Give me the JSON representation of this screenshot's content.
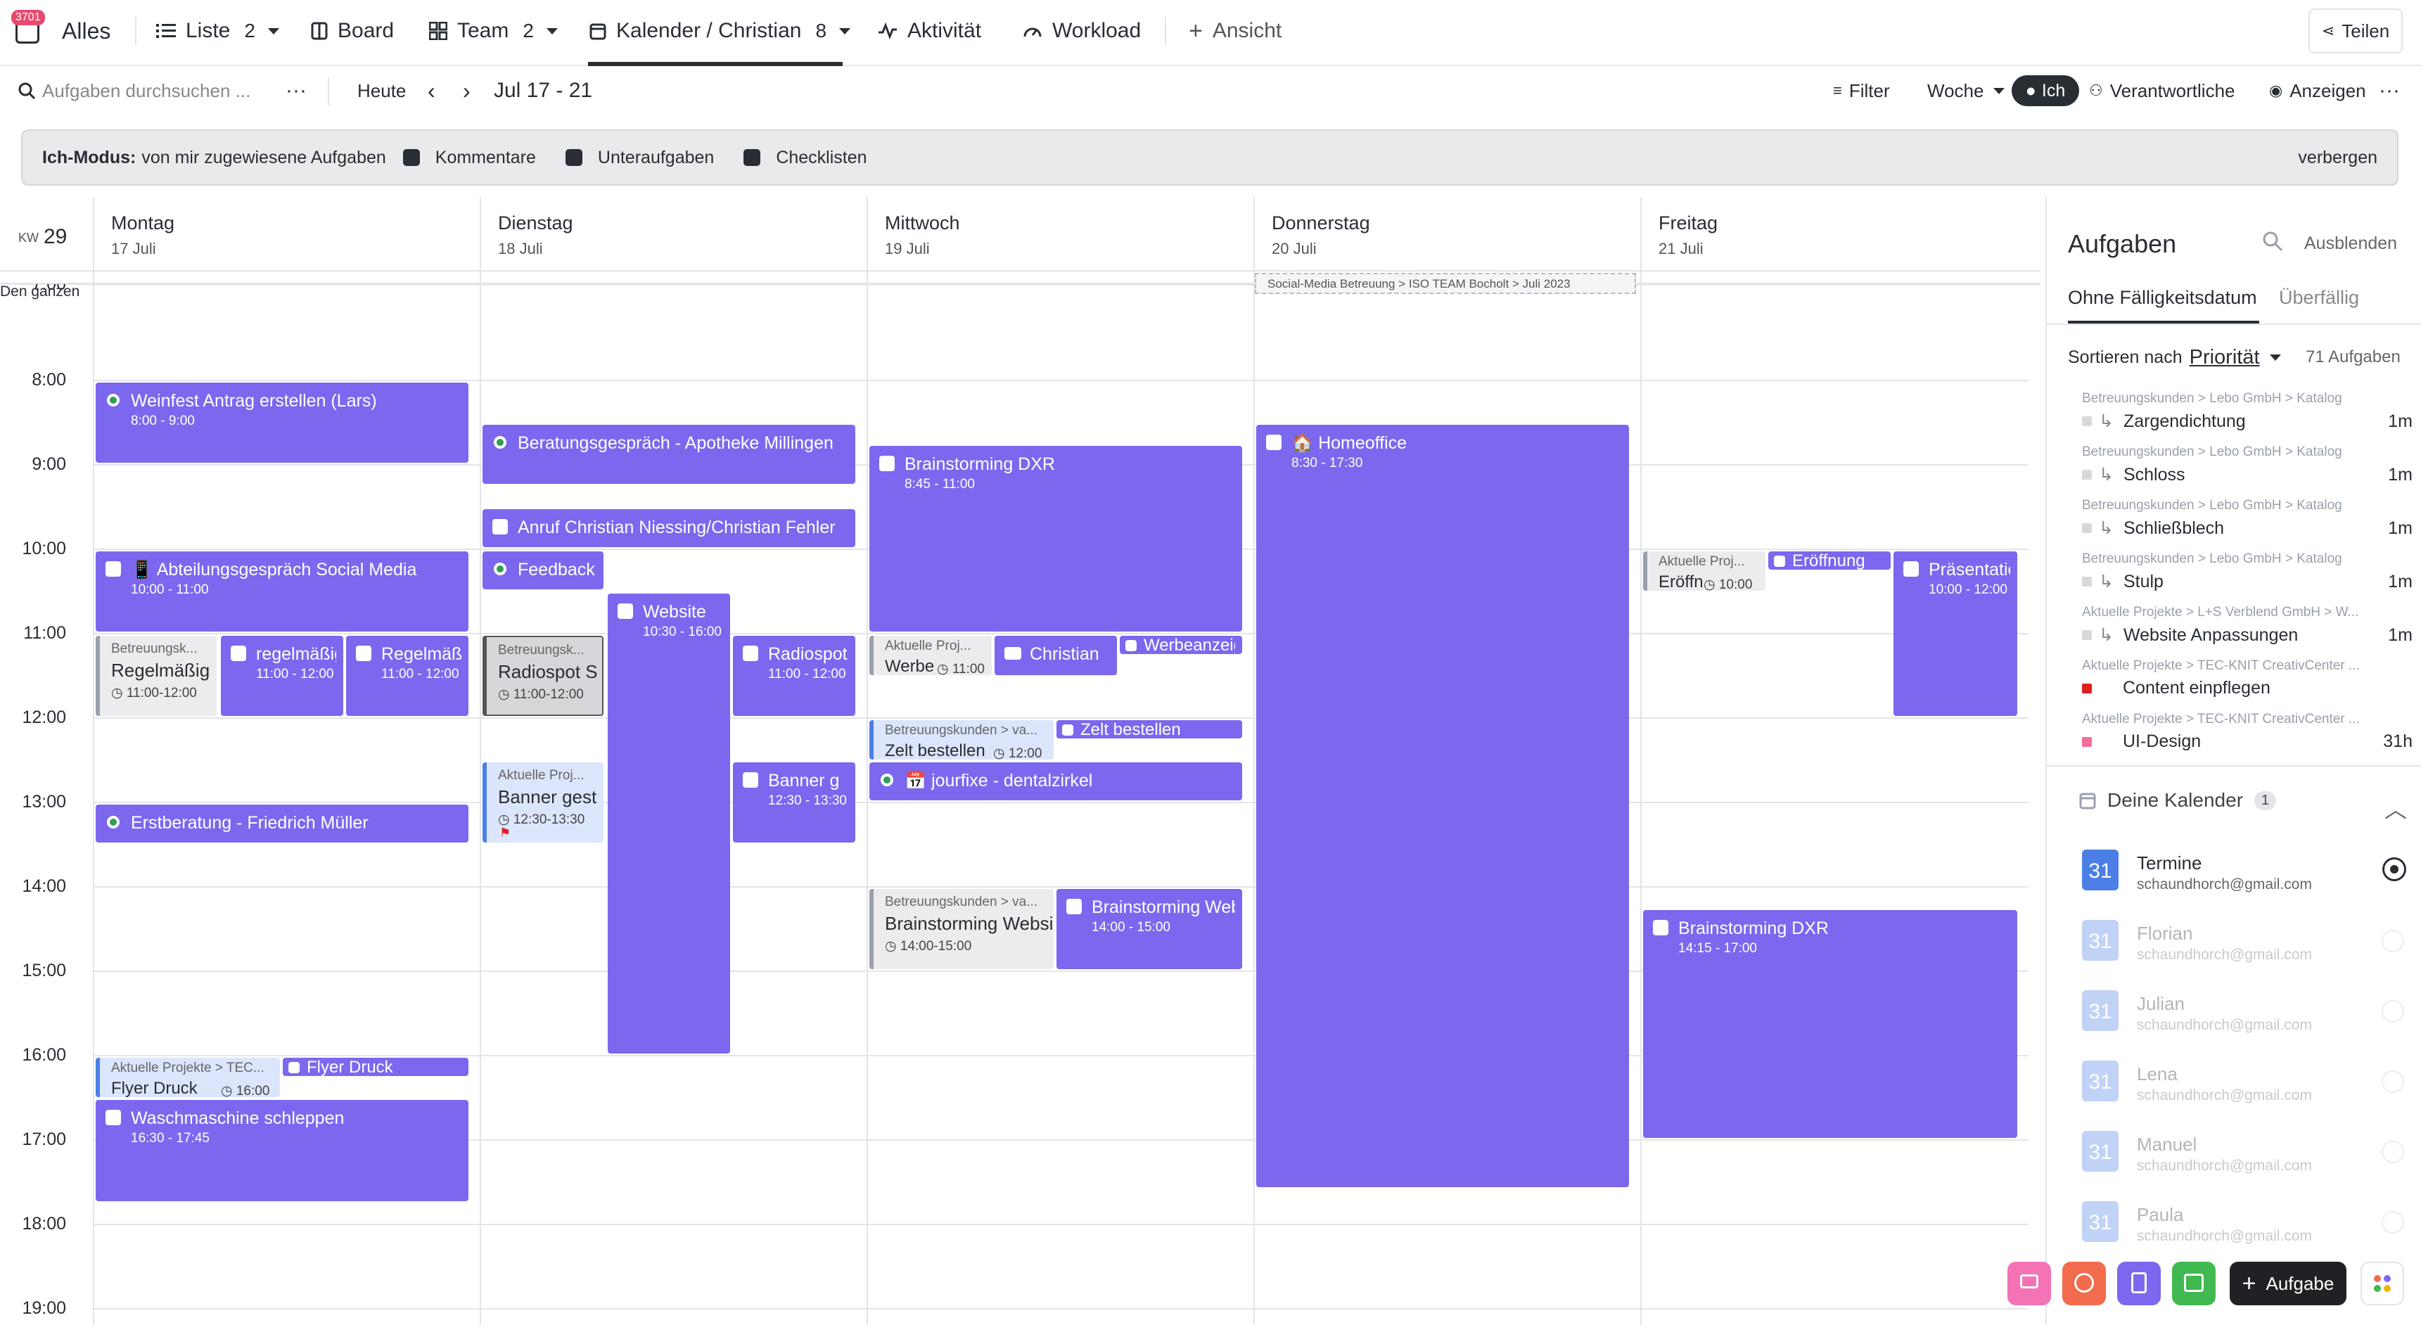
{
  "app": {
    "badge": "3701",
    "title": "Alles"
  },
  "tabs": [
    {
      "label": "Liste",
      "count": "2"
    },
    {
      "label": "Board"
    },
    {
      "label": "Team",
      "count": "2"
    },
    {
      "label": "Kalender / Christian",
      "count": "8"
    },
    {
      "label": "Aktivität"
    },
    {
      "label": "Workload"
    },
    {
      "label": "Ansicht"
    }
  ],
  "share": "Teilen",
  "toolbar": {
    "search_placeholder": "Aufgaben durchsuchen ...",
    "today": "Heute",
    "range": "Jul 17 - 21",
    "filter": "Filter",
    "week": "Woche",
    "me": "Ich",
    "assignees": "Verantwortliche",
    "show": "Anzeigen"
  },
  "banner": {
    "title": "Ich-Modus:",
    "desc": "von mir zugewiesene Aufgaben",
    "opts": [
      "Kommentare",
      "Unteraufgaben",
      "Checklisten"
    ],
    "hide": "verbergen"
  },
  "calendar": {
    "kw": "KW",
    "week": "29",
    "allday": "Den ganzen",
    "days": [
      {
        "name": "Montag",
        "date": "17 Juli"
      },
      {
        "name": "Dienstag",
        "date": "18 Juli"
      },
      {
        "name": "Mittwoch",
        "date": "19 Juli"
      },
      {
        "name": "Donnerstag",
        "date": "20 Juli"
      },
      {
        "name": "Freitag",
        "date": "21 Juli"
      }
    ],
    "hours": [
      "7:00",
      "8:00",
      "9:00",
      "10:00",
      "11:00",
      "12:00",
      "13:00",
      "14:00",
      "15:00",
      "16:00",
      "17:00",
      "18:00",
      "19:00"
    ],
    "allday_event": "Social-Media Betreuung > ISO TEAM Bocholt > Juli 2023",
    "events": {
      "e1": {
        "t": "Weinfest Antrag erstellen (Lars)",
        "s": "8:00 - 9:00"
      },
      "e2": {
        "t": "📱 Abteilungsgespräch Social Media",
        "s": "10:00 - 11:00"
      },
      "e3": {
        "t": "regelmäßig",
        "s": "11:00 - 12:00"
      },
      "e4": {
        "t": "Regelmäßig",
        "s": "11:00 - 12:00"
      },
      "e5": {
        "t": "Erstberatung - Friedrich Müller"
      },
      "e6": {
        "t": "Flyer Druck"
      },
      "e7": {
        "t": "Waschmaschine schleppen",
        "s": "16:30 - 17:45"
      },
      "e8": {
        "t": "Beratungsgespräch - Apotheke Millingen",
        "s": ""
      },
      "e9": {
        "t": "Anruf Christian Niessing/Christian Fehler"
      },
      "e10": {
        "t": "Feedback"
      },
      "e11": {
        "t": "Website",
        "s": "10:30 - 16:00"
      },
      "e12": {
        "t": "Radiospot",
        "s": "11:00 - 12:00"
      },
      "e13": {
        "t": "Banner g",
        "s": "12:30 - 13:30"
      },
      "e14": {
        "t": "Brainstorming DXR",
        "s": "8:45 - 11:00"
      },
      "e15": {
        "t": "Christian"
      },
      "e16": {
        "t": "Werbeanzeige"
      },
      "e17": {
        "t": "Zelt bestellen"
      },
      "e18": {
        "t": "📅 jourfixe - dentalzirkel"
      },
      "e19": {
        "t": "Brainstorming Website",
        "s": "14:00 - 15:00"
      },
      "e20": {
        "t": "🏠 Homeoffice",
        "s": "8:30 - 17:30"
      },
      "e21": {
        "t": "Eröffnung"
      },
      "e22": {
        "t": "Präsentation",
        "s": "10:00 - 12:00"
      },
      "e23": {
        "t": "Brainstorming DXR",
        "s": "14:15 - 17:00"
      }
    },
    "tasks": {
      "k1": {
        "p": "Betreuungsk...",
        "n": "Regelmäßig",
        "tm": "◷ 11:00-12:00"
      },
      "k2": {
        "p": "Aktuelle Projekte > TEC...",
        "n": "Flyer Druck",
        "tm": "◷ 16:00"
      },
      "k3": {
        "p": "Betreuungsk...",
        "n": "Radiospot S",
        "tm": "◷ 11:00-12:00"
      },
      "k4": {
        "p": "Aktuelle Proj...",
        "n": "Banner gest",
        "tm": "◷ 12:30-13:30"
      },
      "k5": {
        "p": "Aktuelle Proj...",
        "n": "Werbe",
        "tm": "◷ 11:00"
      },
      "k6": {
        "p": "Betreuungskunden > va...",
        "n": "Zelt bestellen",
        "tm": "◷ 12:00"
      },
      "k7": {
        "p": "Betreuungskunden > va...",
        "n": "Brainstorming Website",
        "tm": "◷ 14:00-15:00"
      },
      "k8": {
        "p": "Aktuelle Proj...",
        "n": "Eröffn",
        "tm": "◷ 10:00"
      }
    }
  },
  "panel": {
    "title": "Aufgaben",
    "hide": "Ausblenden",
    "tabs": [
      "Ohne Fälligkeitsdatum",
      "Überfällig"
    ],
    "sort_label": "Sortieren nach",
    "sort_value": "Priorität",
    "count": "71 Aufgaben",
    "tasks": [
      {
        "path": "Betreuungskunden > Lebo GmbH > Katalog",
        "name": "Zargendichtung",
        "est": "1m",
        "color": "#d6d8dc"
      },
      {
        "path": "Betreuungskunden > Lebo GmbH > Katalog",
        "name": "Schloss",
        "est": "1m",
        "color": "#d6d8dc"
      },
      {
        "path": "Betreuungskunden > Lebo GmbH > Katalog",
        "name": "Schließblech",
        "est": "1m",
        "color": "#d6d8dc"
      },
      {
        "path": "Betreuungskunden > Lebo GmbH > Katalog",
        "name": "Stulp",
        "est": "1m",
        "color": "#d6d8dc"
      },
      {
        "path": "Aktuelle Projekte > L+S Verblend GmbH > W...",
        "name": "Website Anpassungen",
        "est": "1m",
        "color": "#d6d8dc"
      },
      {
        "path": "Aktuelle Projekte > TEC-KNIT CreativCenter ...",
        "name": "Content einpflegen",
        "est": "",
        "color": "#e02020"
      },
      {
        "path": "Aktuelle Projekte > TEC-KNIT CreativCenter ...",
        "name": "UI-Design",
        "est": "31h",
        "color": "#f26d9a"
      }
    ],
    "cal_section": "Deine Kalender",
    "cal_count": "1",
    "calendars": [
      {
        "name": "Termine",
        "mail": "schaundhorch@gmail.com"
      },
      {
        "name": "Florian",
        "mail": "schaundhorch@gmail.com"
      },
      {
        "name": "Julian",
        "mail": "schaundhorch@gmail.com"
      },
      {
        "name": "Lena",
        "mail": "schaundhorch@gmail.com"
      },
      {
        "name": "Manuel",
        "mail": "schaundhorch@gmail.com"
      },
      {
        "name": "Paula",
        "mail": "schaundhorch@gmail.com"
      }
    ],
    "cal_icon": "31",
    "add_task": "Aufgabe"
  }
}
